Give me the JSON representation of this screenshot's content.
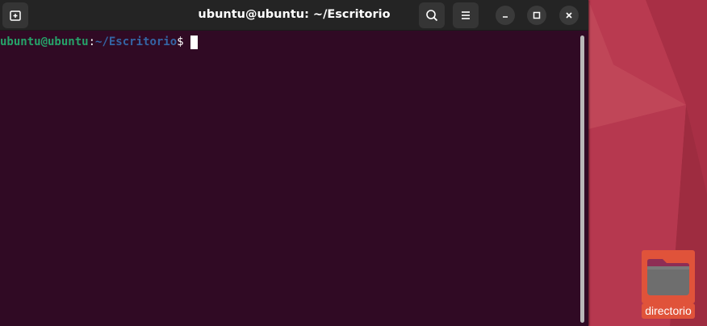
{
  "window": {
    "title": "ubuntu@ubuntu: ~/Escritorio"
  },
  "terminal": {
    "prompt_user": "ubuntu@ubuntu",
    "prompt_sep": ":",
    "prompt_path": "~/Escritorio",
    "prompt_sign": "$"
  },
  "desktop": {
    "icons": [
      {
        "label": "directorio",
        "icon": "folder-icon"
      }
    ]
  },
  "colors": {
    "terminal_bg": "#300a24",
    "headerbar_bg": "#242424",
    "prompt_user": "#26a269",
    "prompt_path": "#3465a4",
    "icon_selection": "#e0533a"
  }
}
